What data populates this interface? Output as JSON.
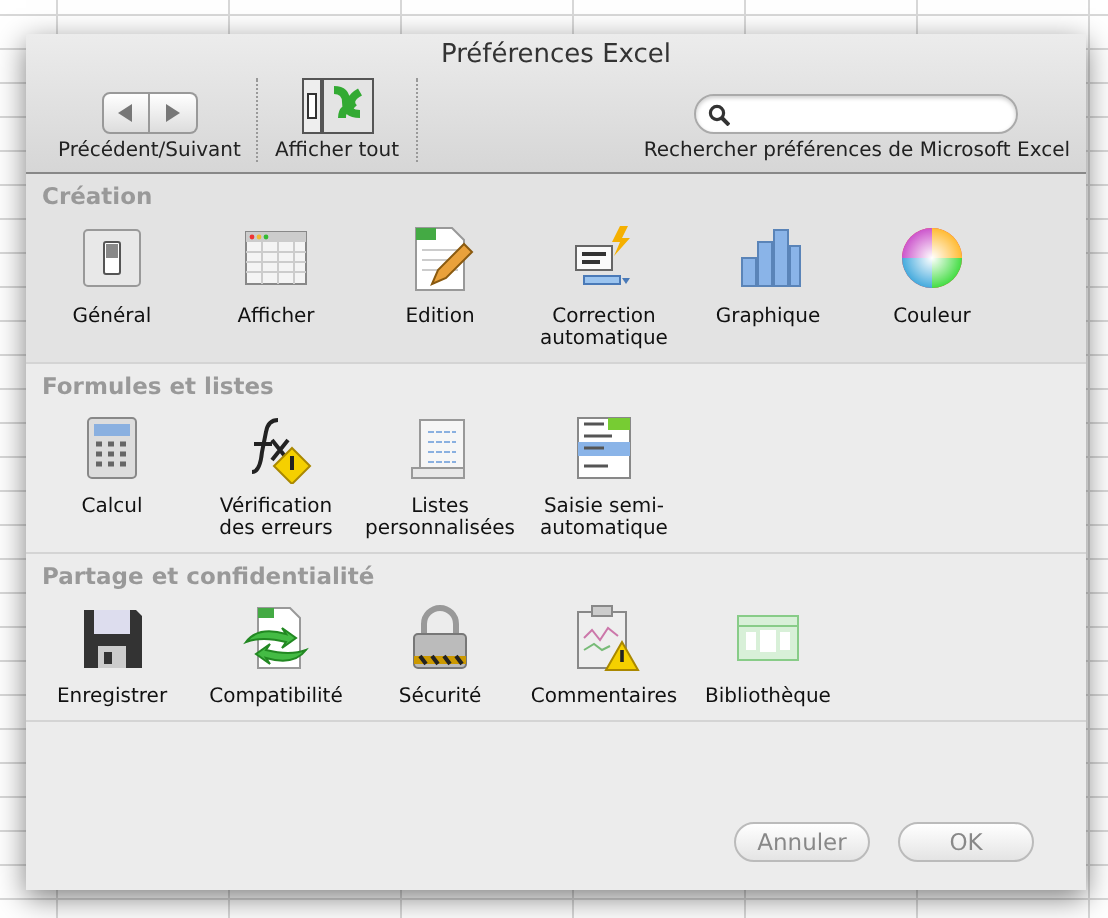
{
  "window": {
    "title": "Préférences Excel"
  },
  "toolbar": {
    "nav_label": "Précédent/Suivant",
    "show_all_label": "Afficher tout",
    "search_label": "Rechercher préférences de Microsoft Excel"
  },
  "sections": [
    {
      "title": "Création",
      "items": [
        {
          "label": "Général"
        },
        {
          "label": "Afficher"
        },
        {
          "label": "Edition"
        },
        {
          "label": "Correction automatique"
        },
        {
          "label": "Graphique"
        },
        {
          "label": "Couleur"
        }
      ]
    },
    {
      "title": "Formules et listes",
      "items": [
        {
          "label": "Calcul"
        },
        {
          "label": "Vérification des erreurs"
        },
        {
          "label": "Listes personnalisées"
        },
        {
          "label": "Saisie semi-automatique"
        }
      ]
    },
    {
      "title": "Partage et confidentialité",
      "items": [
        {
          "label": "Enregistrer"
        },
        {
          "label": "Compatibilité"
        },
        {
          "label": "Sécurité"
        },
        {
          "label": "Commentaires"
        },
        {
          "label": "Bibliothèque"
        }
      ]
    }
  ],
  "buttons": [
    {
      "label": "Annuler",
      "disabled": true
    },
    {
      "label": "OK",
      "disabled": true
    }
  ]
}
